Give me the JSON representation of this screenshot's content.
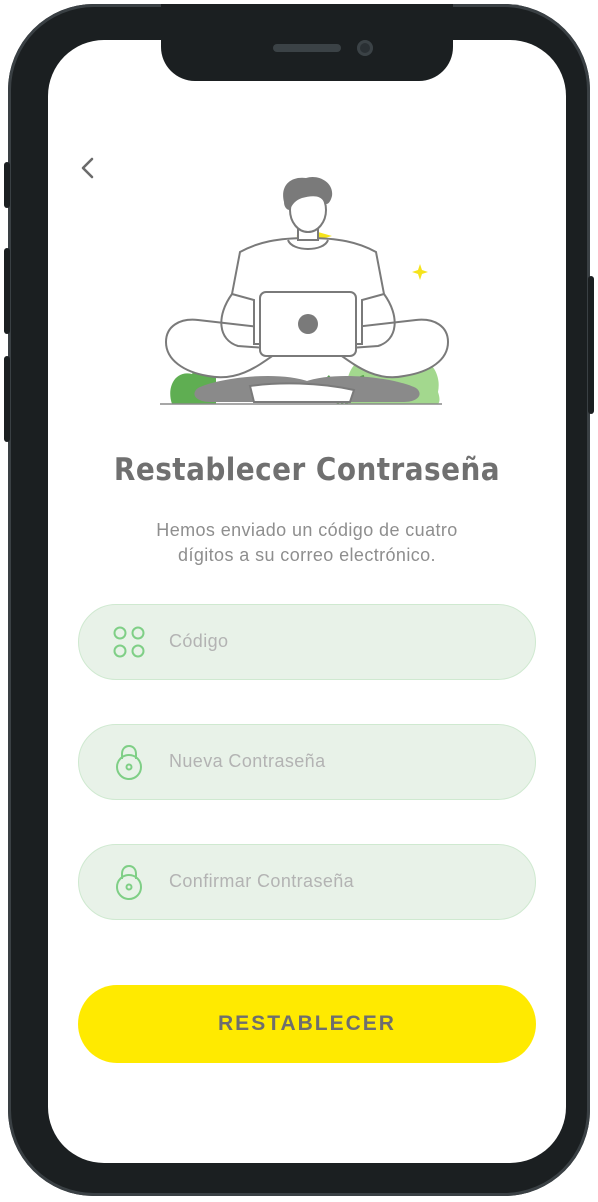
{
  "header": {
    "back_icon": "chevron-left-icon"
  },
  "main": {
    "title": "Restablecer Contraseña",
    "subtitle_line1": "Hemos enviado un código de cuatro",
    "subtitle_line2": "dígitos a su correo electrónico."
  },
  "form": {
    "code": {
      "placeholder": "Código",
      "icon": "four-dots-icon"
    },
    "new_password": {
      "placeholder": "Nueva Contraseña",
      "icon": "lock-icon"
    },
    "confirm_password": {
      "placeholder": "Confirmar Contraseña",
      "icon": "lock-icon"
    }
  },
  "actions": {
    "submit_label": "RESTABLECER"
  },
  "colors": {
    "accent_yellow": "#ffea00",
    "field_bg": "#e8f2e8",
    "icon_green": "#7fcf86",
    "title_gray": "#707070",
    "plant_green": "#9fd68a"
  }
}
